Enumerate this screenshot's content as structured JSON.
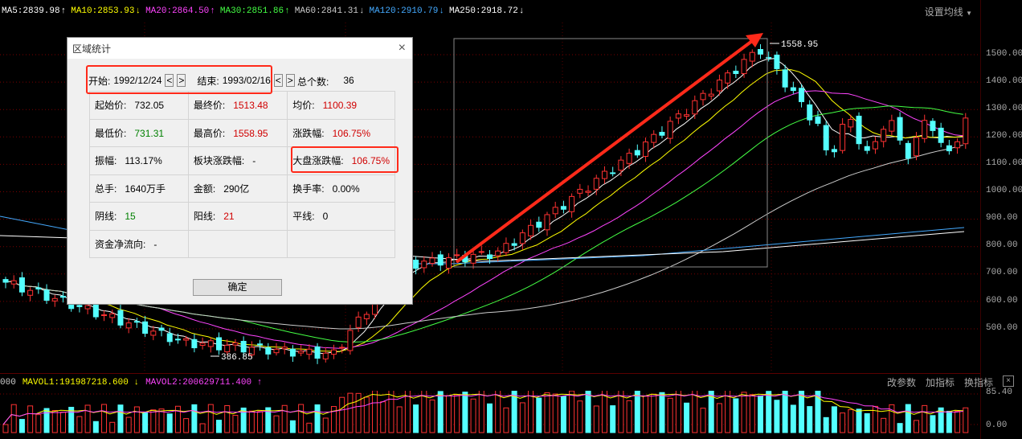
{
  "ma_bar": {
    "items": [
      {
        "label": "MA5:2839.98",
        "color": "#ffffff",
        "dir": "up"
      },
      {
        "label": "MA10:2853.93",
        "color": "#ffff00",
        "dir": "down"
      },
      {
        "label": "MA20:2864.50",
        "color": "#ff44ff",
        "dir": "up"
      },
      {
        "label": "MA30:2851.86",
        "color": "#44ff44",
        "dir": "up"
      },
      {
        "label": "MA60:2841.31",
        "color": "#cccccc",
        "dir": "down"
      },
      {
        "label": "MA120:2910.79",
        "color": "#44aaff",
        "dir": "down"
      },
      {
        "label": "MA250:2918.72",
        "color": "#ffffff",
        "dir": "down"
      }
    ],
    "setting_label": "设置均线"
  },
  "price_axis": [
    "1500.00",
    "1400.00",
    "1300.00",
    "1200.00",
    "1100.00",
    "1000.00",
    "900.00",
    "800.00",
    "700.00",
    "600.00",
    "500.00"
  ],
  "annotations": {
    "high_label": "1558.95",
    "low_label": "386.85"
  },
  "volume": {
    "prefix": "000",
    "mavol1": "MAVOL1:191987218.600",
    "mavol2": "MAVOL2:200629711.400",
    "tools": [
      "改参数",
      "加指标",
      "换指标"
    ],
    "close": "×",
    "axis": [
      "85.40",
      "0.00"
    ]
  },
  "dialog": {
    "title": "区域统计",
    "close": "×",
    "start_label": "开始:",
    "start_date": "1992/12/24",
    "end_label": "结束:",
    "end_date": "1993/02/16",
    "spin_left": "<",
    "spin_right": ">",
    "total_label": "总个数:",
    "total_value": "36",
    "rows": [
      [
        {
          "label": "起始价:",
          "value": "732.05",
          "color": "blk"
        },
        {
          "label": "最终价:",
          "value": "1513.48",
          "color": "red"
        },
        {
          "label": "均价:",
          "value": "1100.39",
          "color": "red"
        }
      ],
      [
        {
          "label": "最低价:",
          "value": "731.31",
          "color": "grn"
        },
        {
          "label": "最高价:",
          "value": "1558.95",
          "color": "red"
        },
        {
          "label": "涨跌幅:",
          "value": "106.75%",
          "color": "red"
        }
      ],
      [
        {
          "label": "振幅:",
          "value": "113.17%",
          "color": "blk"
        },
        {
          "label": "板块涨跌幅:",
          "value": "-",
          "color": "blk"
        },
        {
          "label": "大盘涨跌幅:",
          "value": "106.75%",
          "color": "red"
        }
      ],
      [
        {
          "label": "总手:",
          "value": "1640万手",
          "color": "blk"
        },
        {
          "label": "金额:",
          "value": "290亿",
          "color": "blk"
        },
        {
          "label": "换手率:",
          "value": "0.00%",
          "color": "blk"
        }
      ],
      [
        {
          "label": "阴线:",
          "value": "15",
          "color": "grn"
        },
        {
          "label": "阳线:",
          "value": "21",
          "color": "red"
        },
        {
          "label": "平线:",
          "value": "0",
          "color": "blk"
        }
      ],
      [
        {
          "label": "资金净流向:",
          "value": "-",
          "color": "blk"
        },
        {
          "label": "",
          "value": "",
          "color": "blk"
        },
        {
          "label": "",
          "value": "",
          "color": "blk"
        }
      ]
    ],
    "ok_label": "确定"
  }
}
